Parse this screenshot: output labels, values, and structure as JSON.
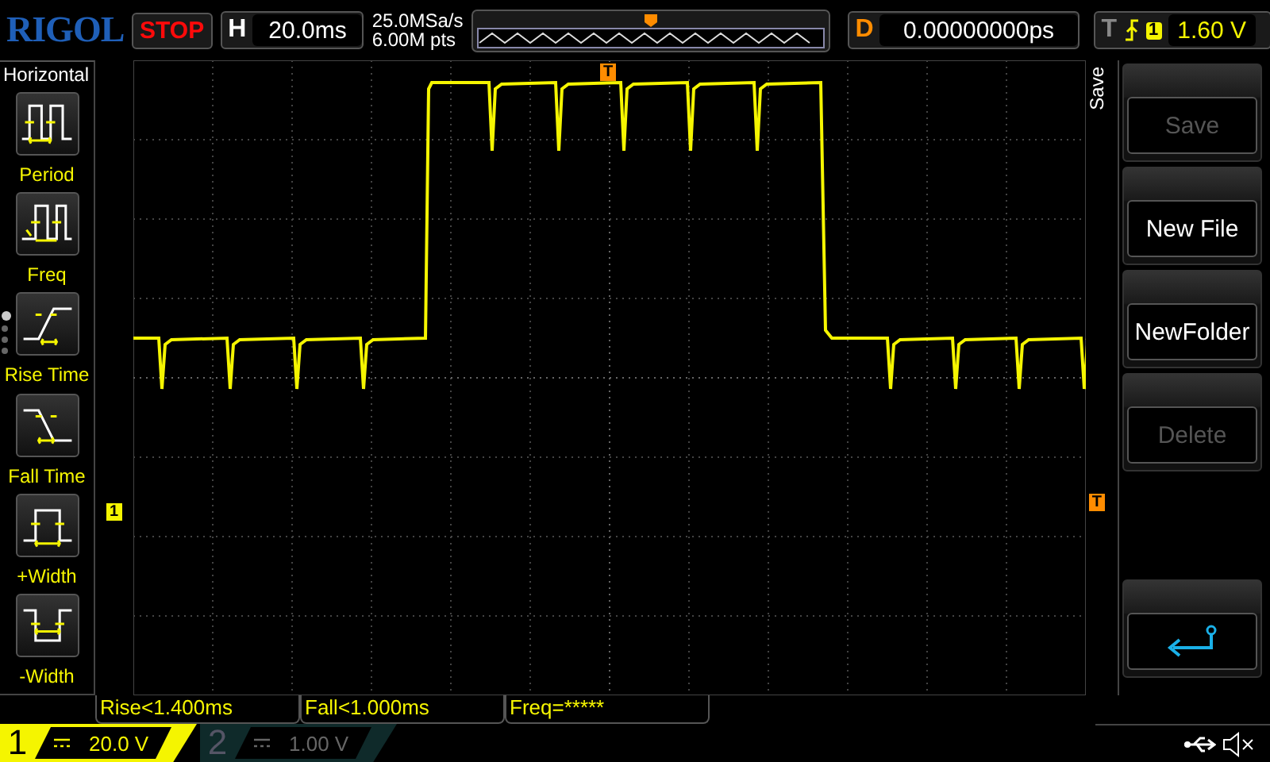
{
  "header": {
    "logo": "RIGOL",
    "run_state": "STOP",
    "timebase": {
      "label": "H",
      "value": "20.0ms"
    },
    "sample_rate": "25.0MSa/s",
    "memory_depth": "6.00M pts",
    "delay": {
      "label": "D",
      "value": "0.00000000ps"
    },
    "trigger": {
      "label": "T",
      "source": "1",
      "level": "1.60 V"
    }
  },
  "measure_menu": {
    "title": "Horizontal",
    "items": [
      {
        "kind": "period",
        "label": "Period"
      },
      {
        "kind": "freq",
        "label": "Freq"
      },
      {
        "kind": "rise",
        "label": "Rise Time"
      },
      {
        "kind": "fall",
        "label": "Fall Time"
      },
      {
        "kind": "pwidth",
        "label": "+Width"
      },
      {
        "kind": "nwidth",
        "label": "-Width"
      }
    ],
    "pages": [
      {
        "selected": true
      },
      {
        "selected": false
      },
      {
        "selected": false
      },
      {
        "selected": false
      }
    ]
  },
  "markers": {
    "channel": "1",
    "trigger_level": "T",
    "trigger_position": "T"
  },
  "measurements": [
    {
      "text": "Rise<1.400ms"
    },
    {
      "text": "Fall<1.000ms"
    },
    {
      "text": "Freq=*****"
    }
  ],
  "softkey_menu": {
    "title": "Save",
    "keys": [
      {
        "kind": "text",
        "label": "Save",
        "disabled": true
      },
      {
        "kind": "text",
        "label": "New File",
        "disabled": false
      },
      {
        "kind": "text",
        "label": "NewFolder",
        "disabled": false
      },
      {
        "kind": "text",
        "label": "Delete",
        "disabled": true
      },
      {
        "kind": "blank"
      },
      {
        "kind": "back"
      }
    ]
  },
  "channels": [
    {
      "number": "1",
      "active": true,
      "value": "20.0 V"
    },
    {
      "number": "2",
      "active": false,
      "value": "1.00 V"
    }
  ]
}
